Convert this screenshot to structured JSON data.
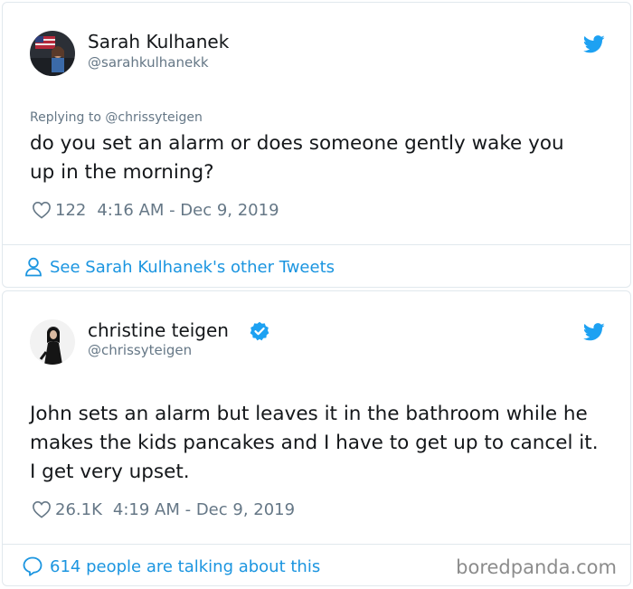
{
  "tweets": [
    {
      "author_name": "Sarah Kulhanek",
      "author_handle": "@sarahkulhanekk",
      "verified": false,
      "replying_to": "Replying to @chrissyteigen",
      "text": "do you set an alarm or does someone gently wake you up in the morning?",
      "likes": "122",
      "timestamp": "4:16 AM - Dec 9, 2019",
      "footer_link": "See Sarah Kulhanek's other Tweets",
      "footer_icon": "person-icon"
    },
    {
      "author_name": "christine teigen",
      "author_handle": "@chrissyteigen",
      "verified": true,
      "text": "John sets an alarm but leaves it in the bathroom while he makes the kids pancakes and I have to get up to cancel it. I get very upset.",
      "likes": "26.1K",
      "timestamp": "4:19 AM - Dec 9, 2019",
      "footer_link": "614 people are talking about this",
      "footer_icon": "speech-bubble-icon"
    }
  ],
  "watermark": "boredpanda.com",
  "colors": {
    "twitter_blue": "#1da1f2",
    "link_blue": "#1b95e0",
    "secondary_text": "#657786",
    "border": "#e1e8ed"
  }
}
